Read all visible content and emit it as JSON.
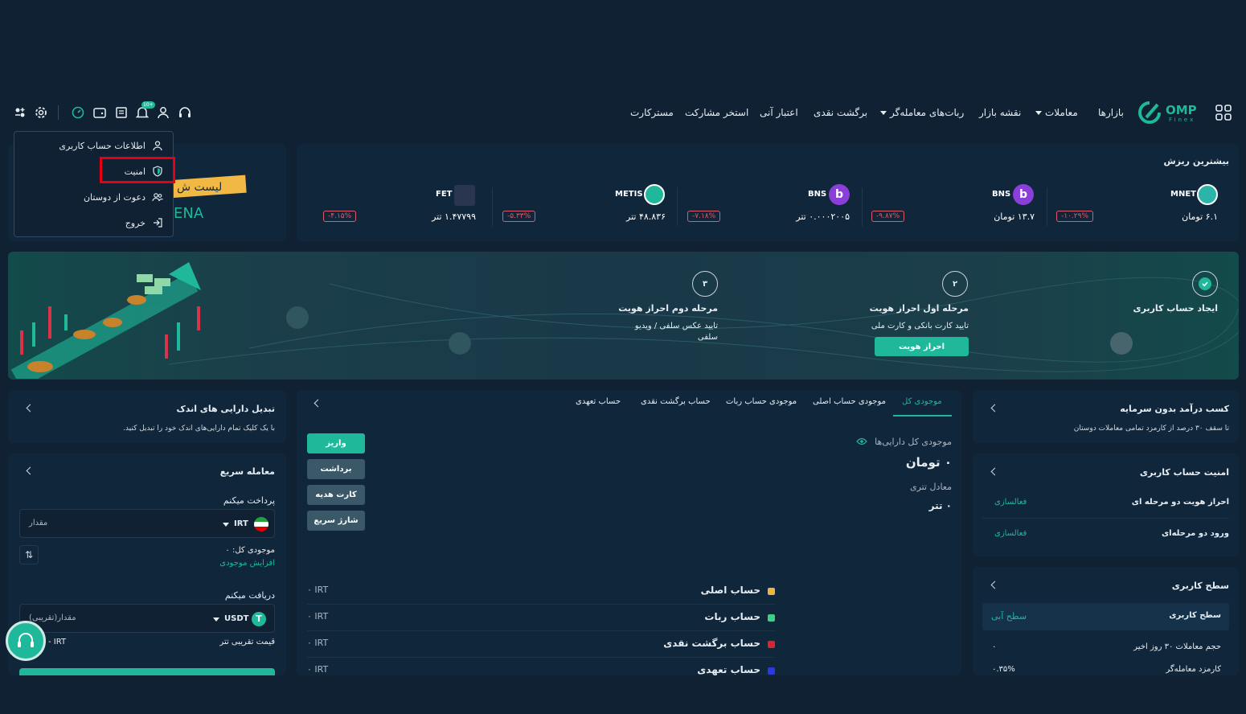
{
  "header": {
    "brand": "OMP",
    "brand_sub": "Finex",
    "nav": [
      {
        "label": "بازارها"
      },
      {
        "label": "معاملات"
      },
      {
        "label": "نقشه بازار"
      },
      {
        "label": "ربات‌های معامله‌گر"
      },
      {
        "label": "برگشت نقدی"
      },
      {
        "label": "اعتبار آنی"
      },
      {
        "label": "استخر مشارکت"
      },
      {
        "label": "مسترکارت"
      }
    ],
    "notification_badge": "10+"
  },
  "user_menu": {
    "items": [
      {
        "label": "اطلاعات حساب کاربری",
        "icon": "user-icon"
      },
      {
        "label": "امنیت",
        "icon": "shield-icon"
      },
      {
        "label": "دعوت از دوستان",
        "icon": "users-icon"
      },
      {
        "label": "خروج",
        "icon": "logout-icon"
      }
    ]
  },
  "banner_partial": {
    "ribbon": "لیست ش",
    "text": "ENA"
  },
  "top_losers": {
    "title": "بیشترین ریزش",
    "items": [
      {
        "symbol": "MNET",
        "price": "۶.۱ تومان",
        "change": "-۱۰.۲۹%",
        "color": "#2ab5a8"
      },
      {
        "symbol": "BNS",
        "price": "۱۳.۷ تومان",
        "change": "-۹.۸۷%",
        "color": "#8b3fd9"
      },
      {
        "symbol": "BNS",
        "price": "۰.۰۰۰۲۰۰۵ تتر",
        "change": "-۷.۱۸%",
        "color": "#8b3fd9"
      },
      {
        "symbol": "METIS",
        "price": "۴۸.۸۳۶ تتر",
        "change": "-۵.۳۳%",
        "color": "#1fb89a"
      },
      {
        "symbol": "FET",
        "price": "۱.۴۷۷۹۹ تتر",
        "change": "-۴.۱۵%",
        "color": "#3a4a6a"
      }
    ]
  },
  "steps": [
    {
      "title": "ایجاد حساب کاربری",
      "desc": "",
      "num": "✓"
    },
    {
      "title": "مرحله اول احراز هویت",
      "desc": "تایید کارت بانکی و کارت ملی",
      "num": "۲",
      "button": "احراز هویت"
    },
    {
      "title": "مرحله دوم احراز هویت",
      "desc": "تایید عکس سلفی / ویدیو سلفی",
      "num": "۳"
    }
  ],
  "wallet": {
    "tabs": [
      "موجودی کل",
      "موجودی حساب اصلی",
      "موجودی حساب ربات",
      "حساب برگشت نقدی",
      "حساب تعهدی"
    ],
    "total_label": "موجودی کل دارایی‌ها",
    "total_value": "۰ تومان",
    "usdt_label": "معادل تتری",
    "usdt_value": "۰ تتر",
    "actions": [
      "واریز",
      "برداشت",
      "کارت هدیه",
      "شارژ سریع"
    ],
    "accounts": [
      {
        "name": "حساب اصلی",
        "value": "۰ IRT",
        "color": "#f0b43c"
      },
      {
        "name": "حساب ربات",
        "value": "۰ IRT",
        "color": "#3ed08a"
      },
      {
        "name": "حساب برگشت نقدی",
        "value": "۰ IRT",
        "color": "#d9262e"
      },
      {
        "name": "حساب تعهدی",
        "value": "۰ IRT",
        "color": "#2a3ae0"
      }
    ]
  },
  "convert_small": {
    "title": "تبدیل دارایی های اندک",
    "desc": "با یک کلیک تمام دارایی‌های اندک خود را تبدیل کنید."
  },
  "quick_trade": {
    "title": "معامله سریع",
    "pay_label": "پرداخت میکنم",
    "pay_currency": "IRT",
    "pay_placeholder": "مقدار",
    "balance_label": "موجودی کل: ۰",
    "increase_label": "افزایش موجودی",
    "receive_label": "دریافت میکنم",
    "receive_currency": "USDT",
    "receive_placeholder": "مقدار(تقریبی)",
    "price_label": "قیمت تقریبی تتر",
    "price_value": "- IRT"
  },
  "earn": {
    "title": "کسب درآمد بدون سرمایه",
    "desc": "تا سقف ۳۰ درصد از کارمزد تمامی معاملات دوستان"
  },
  "security": {
    "title": "امنیت حساب کاربری",
    "rows": [
      {
        "label": "احراز هویت دو مرحله ای",
        "action": "فعالسازی"
      },
      {
        "label": "ورود دو مرحله‌ای",
        "action": "فعالسازی"
      }
    ]
  },
  "level": {
    "title": "سطح کاربری",
    "level_label": "سطح کاربری",
    "level_value": "سطح آبی",
    "volume_label": "حجم معاملات ۳۰ روز اخیر",
    "volume_value": "۰",
    "fee_label": "کارمزد معامله‌گر",
    "fee_value": "۰.۳۵%"
  }
}
